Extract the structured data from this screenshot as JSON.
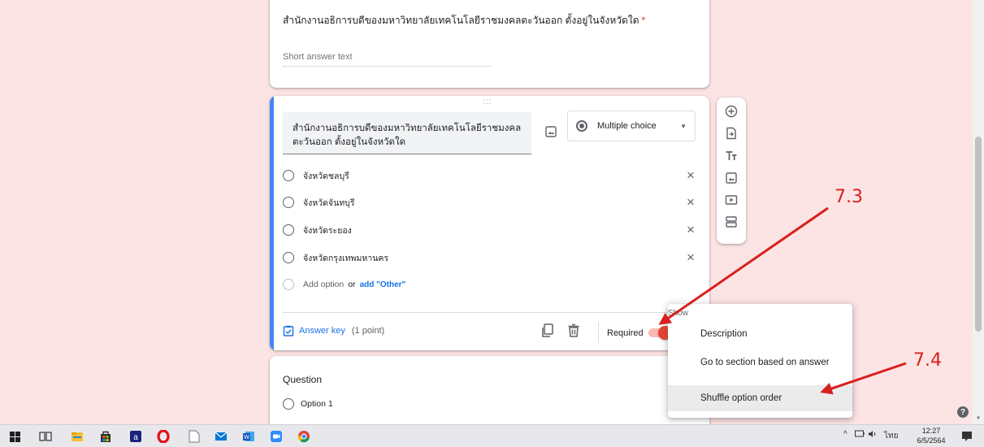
{
  "previous_question": {
    "title": "สำนักงานอธิการบดีของมหาวิทยาลัยเทคโนโลยีราชมงคลตะวันออก ตั้งอยู่ในจังหวัดใด",
    "required_marker": "*",
    "answer_placeholder": "Short answer text"
  },
  "active_question": {
    "drag_handle": ":::",
    "title_line1": "สำนักงานอธิการบดีของมหาวิทยาลัยเทคโนโลยีราชมงคล",
    "title_line2": "ตะวันออก ตั้งอยู่ในจังหวัดใด",
    "type": "Multiple choice",
    "options": [
      {
        "label": "จังหวัดชลบุรี"
      },
      {
        "label": "จังหวัดจันทบุรี"
      },
      {
        "label": "จังหวัดระยอง"
      },
      {
        "label": "จังหวัดกรุงเทพมหานคร"
      }
    ],
    "remove_glyph": "×",
    "add_option": "Add option",
    "add_option_or": "or",
    "add_other": "add \"Other\"",
    "answer_key": "Answer key",
    "points": "(1 point)",
    "required_label": "Required",
    "required_on": true
  },
  "next_question": {
    "title": "Question",
    "option": "Option 1"
  },
  "menu": {
    "header": "Show",
    "items": [
      "Description",
      "Go to section based on answer",
      "Shuffle option order"
    ]
  },
  "annotations": {
    "label_1": "7.3",
    "label_2": "7.4"
  },
  "taskbar": {
    "search_glyph": "a",
    "tray_lang": "ไทย",
    "time": "12:27",
    "date": "6/5/2564"
  },
  "colors": {
    "background": "#fde4e4",
    "accent_blue": "#1a73e8",
    "accent_red": "#ea4335",
    "annotation": "#d9201e"
  }
}
